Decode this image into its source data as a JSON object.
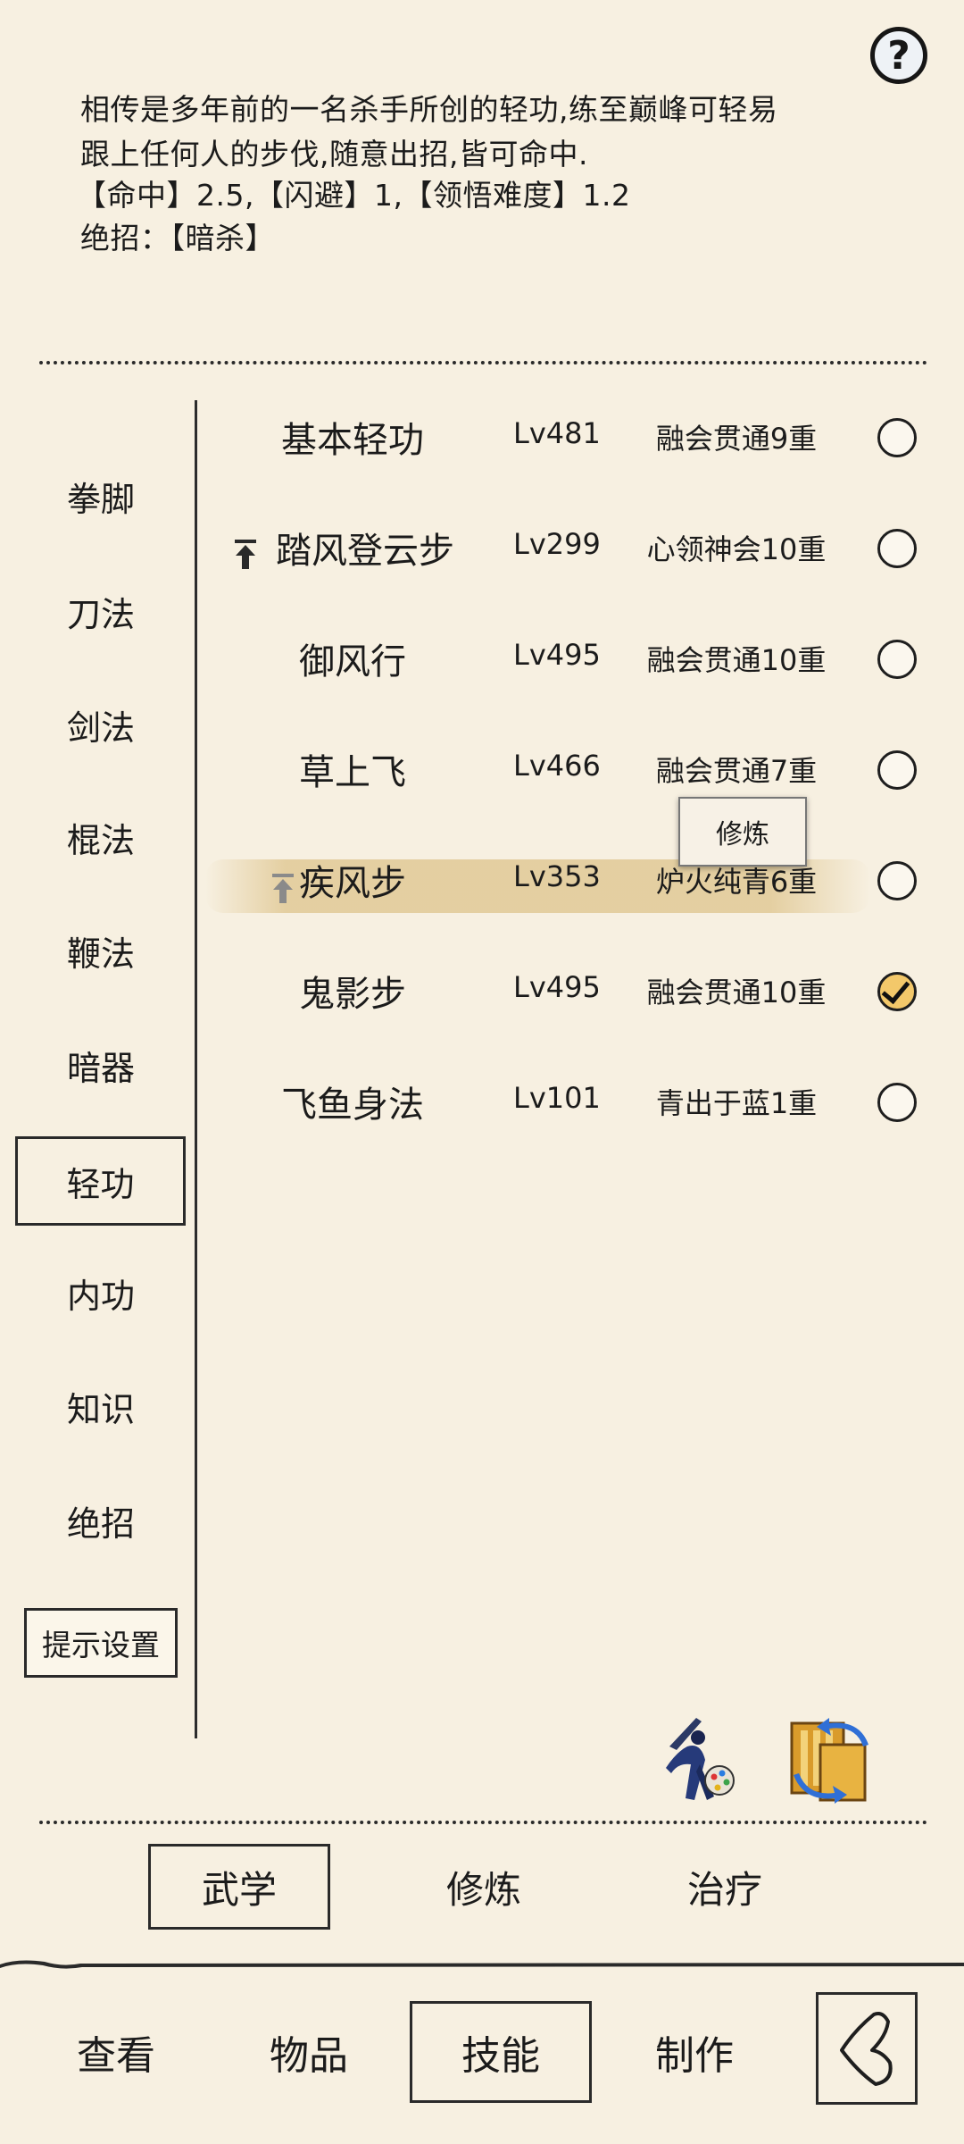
{
  "description": {
    "line1": "相传是多年前的一名杀手所创的轻功,练至巅峰可轻易",
    "line2": "跟上任何人的步伐,随意出招,皆可命中.",
    "line3": "【命中】2.5,【闪避】1,【领悟难度】1.2",
    "line4": "绝招：【暗杀】"
  },
  "categories": [
    "拳脚",
    "刀法",
    "剑法",
    "棍法",
    "鞭法",
    "暗器",
    "轻功",
    "内功",
    "知识",
    "绝招"
  ],
  "active_category": "轻功",
  "tip_settings_label": "提示设置",
  "skills": [
    {
      "name": "基本轻功",
      "level": "Lv481",
      "rank": "融会贯通9重",
      "checked": false,
      "upgrade": false
    },
    {
      "name": "踏风登云步",
      "level": "Lv299",
      "rank": "心领神会10重",
      "checked": false,
      "upgrade": true
    },
    {
      "name": "御风行",
      "level": "Lv495",
      "rank": "融会贯通10重",
      "checked": false,
      "upgrade": false
    },
    {
      "name": "草上飞",
      "level": "Lv466",
      "rank": "融会贯通7重",
      "checked": false,
      "upgrade": false
    },
    {
      "name": "疾风步",
      "level": "Lv353",
      "rank": "炉火纯青6重",
      "checked": false,
      "upgrade": true
    },
    {
      "name": "鬼影步",
      "level": "Lv495",
      "rank": "融会贯通10重",
      "checked": true,
      "upgrade": false
    },
    {
      "name": "飞鱼身法",
      "level": "Lv101",
      "rank": "青出于蓝1重",
      "checked": false,
      "upgrade": false
    }
  ],
  "train_popup_label": "修炼",
  "sub_tabs": [
    "武学",
    "修炼",
    "治疗"
  ],
  "active_sub_tab": "武学",
  "bottom_nav": [
    "查看",
    "物品",
    "技能",
    "制作"
  ],
  "active_nav": "技能",
  "icons": {
    "help": "question-mark-icon",
    "character": "swordsman-palette-icon",
    "swap": "book-swap-icon",
    "back": "back-arrow-icon"
  }
}
